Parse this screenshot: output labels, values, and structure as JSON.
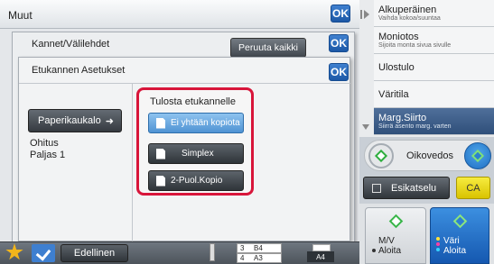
{
  "main": {
    "title": "Muut",
    "ok_label": "OK"
  },
  "sheet1": {
    "title": "Kannet/Välilehdet",
    "cancel_all_label": "Peruuta kaikki",
    "ok_label": "OK"
  },
  "sheet2": {
    "title": "Etukannen Asetukset",
    "ok_label": "OK",
    "paper_tray_label": "Paperikaukalo",
    "tray_info_line1": "Ohitus",
    "tray_info_line2": "Paljas 1",
    "print_cover": {
      "caption": "Tulosta etukannelle",
      "options": [
        {
          "label": "Ei yhtään kopiota",
          "selected": true
        },
        {
          "label": "Simplex",
          "selected": false
        },
        {
          "label": "2-Puol.Kopio",
          "selected": false
        }
      ]
    }
  },
  "right_menu": {
    "items": [
      {
        "title": "Alkuperäinen",
        "sub": "Vaihda kokoa/suuntaa"
      },
      {
        "title": "Moniotos",
        "sub": "Sijoita monta sivua sivulle"
      },
      {
        "title": "Ulostulo",
        "sub": ""
      },
      {
        "title": "Väritila",
        "sub": ""
      },
      {
        "title": "Marg.Siirto",
        "sub": "Siirrä asento marg. varten"
      }
    ]
  },
  "proof": {
    "label": "Oikovedos"
  },
  "preview": {
    "label": "Esikatselu"
  },
  "ca": {
    "label": "CA"
  },
  "start": {
    "mono_line1": "M/V",
    "mono_line2": "Aloita",
    "color_line1": "Väri",
    "color_line2": "Aloita"
  },
  "bottom": {
    "prev_label": "Edellinen",
    "tray_rows": [
      {
        "num": "3",
        "size": "B4"
      },
      {
        "num": "4",
        "size": "A3"
      }
    ],
    "paper_size": "A4"
  },
  "colors": {
    "accent_blue": "#1c58a6",
    "highlight_red": "#d8153a",
    "ca_yellow": "#f7ec3f",
    "selected_option": "#4f93d3"
  }
}
